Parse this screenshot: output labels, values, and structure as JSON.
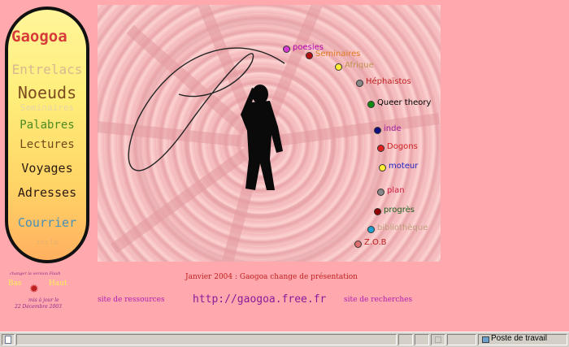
{
  "nav": {
    "logo": "Gaogoa",
    "items": [
      {
        "label": "Entrelacs",
        "color": "#d8b890"
      },
      {
        "label": "Noeuds",
        "color": "#7a4a20"
      },
      {
        "label": "Seminaires",
        "color": "#e6d7a8"
      },
      {
        "label": "Palabres",
        "color": "#4a8a20"
      },
      {
        "label": "Lectures",
        "color": "#6d4a1a"
      },
      {
        "label": "Voyages",
        "color": "#2a1a10"
      },
      {
        "label": "Adresses",
        "color": "#2a1a10"
      },
      {
        "label": "Courrier",
        "color": "#4a90b8"
      },
      {
        "label": "inclo",
        "color": "#e6b070"
      }
    ]
  },
  "hero_links": [
    {
      "label": "poesies",
      "dot": "#d23ad2",
      "color": "#b000b0"
    },
    {
      "label": "Seminaires",
      "dot": "#b01010",
      "color": "#e07a20"
    },
    {
      "label": "Afrique",
      "dot": "#ffee33",
      "color": "#c09050"
    },
    {
      "label": "Héphaïstos",
      "dot": "#888888",
      "color": "#c02020"
    },
    {
      "label": "Queer theory",
      "dot": "#138a13",
      "color": "#000000"
    },
    {
      "label": "inde",
      "dot": "#101080",
      "color": "#a020a0"
    },
    {
      "label": "Dogons",
      "dot": "#e02020",
      "color": "#d02020"
    },
    {
      "label": "moteur",
      "dot": "#ffee33",
      "color": "#2020c0"
    },
    {
      "label": "plan",
      "dot": "#888888",
      "color": "#d02040"
    },
    {
      "label": "progrès",
      "dot": "#900000",
      "color": "#206020"
    },
    {
      "label": "bibliothèque",
      "dot": "#22a0d0",
      "color": "#c0a080"
    },
    {
      "label": "Z.O.B",
      "dot": "#e07070",
      "color": "#c02020"
    }
  ],
  "left_side": {
    "flash": "changer la version Flash",
    "bas": "Bas",
    "haut": "Haut",
    "update_line1": "mis à jour le",
    "update_line2": "22 Décembre 2003"
  },
  "bottom": {
    "announcement": "Janvier 2004 : Gaogoa change de présentation",
    "resources": "site de ressources",
    "url": "http://gaogoa.free.fr",
    "research": "site de recherches"
  },
  "status": {
    "zone": "Poste de travail"
  }
}
